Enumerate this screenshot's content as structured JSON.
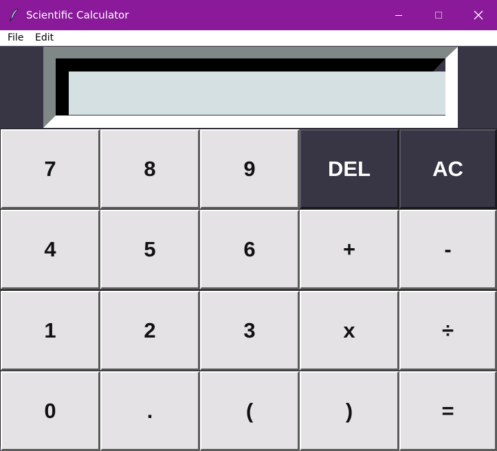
{
  "window": {
    "title": "Scientific Calculator",
    "icon": "feather-icon"
  },
  "menu": {
    "file": "File",
    "edit": "Edit"
  },
  "display": {
    "value": ""
  },
  "colors": {
    "titlebar": "#8a1a9a",
    "app_background": "#383545",
    "key_light": "#e4e2e5",
    "key_dark": "#383545",
    "display_screen": "#d5e0e2",
    "display_bevel_dark": "#000000",
    "display_bevel_light": "#ffffff",
    "display_bevel_gray": "#808887"
  },
  "keys": [
    {
      "label": "7",
      "name": "key-7",
      "style": "light"
    },
    {
      "label": "8",
      "name": "key-8",
      "style": "light"
    },
    {
      "label": "9",
      "name": "key-9",
      "style": "light"
    },
    {
      "label": "DEL",
      "name": "delete-button",
      "style": "dark"
    },
    {
      "label": "AC",
      "name": "all-clear-button",
      "style": "dark"
    },
    {
      "label": "4",
      "name": "key-4",
      "style": "light"
    },
    {
      "label": "5",
      "name": "key-5",
      "style": "light"
    },
    {
      "label": "6",
      "name": "key-6",
      "style": "light"
    },
    {
      "label": "+",
      "name": "add-button",
      "style": "light"
    },
    {
      "label": "-",
      "name": "subtract-button",
      "style": "light"
    },
    {
      "label": "1",
      "name": "key-1",
      "style": "light"
    },
    {
      "label": "2",
      "name": "key-2",
      "style": "light"
    },
    {
      "label": "3",
      "name": "key-3",
      "style": "light"
    },
    {
      "label": "x",
      "name": "multiply-button",
      "style": "light"
    },
    {
      "label": "÷",
      "name": "divide-button",
      "style": "light"
    },
    {
      "label": "0",
      "name": "key-0",
      "style": "light"
    },
    {
      "label": ".",
      "name": "decimal-button",
      "style": "light"
    },
    {
      "label": "(",
      "name": "open-paren-button",
      "style": "light"
    },
    {
      "label": ")",
      "name": "close-paren-button",
      "style": "light"
    },
    {
      "label": "=",
      "name": "equals-button",
      "style": "light"
    }
  ]
}
